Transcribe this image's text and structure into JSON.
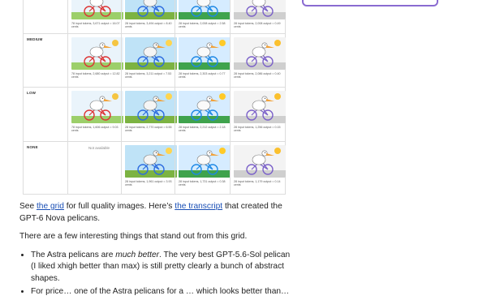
{
  "grid": {
    "rows": [
      {
        "label": "",
        "cells": [
          {
            "caption": "78 input tokens, 3,671 output = 16.07 cents",
            "scene": "a"
          },
          {
            "caption": "28 input tokens, 3,494 output = 8.40 cents",
            "scene": "b"
          },
          {
            "caption": "28 input tokens, 2,008 output = 2.58 cents",
            "scene": "c"
          },
          {
            "caption": "28 input tokens, 2,008 output = 0.49 cents",
            "scene": "d"
          }
        ]
      },
      {
        "label": "MEDIUM",
        "cells": [
          {
            "caption": "78 input tokens, 2,680 output = 12.82 cents",
            "scene": "a"
          },
          {
            "caption": "28 input tokens, 3,211 output = 7.53 cents",
            "scene": "b"
          },
          {
            "caption": "28 input tokens, 2,303 output = 0.77 cents",
            "scene": "c"
          },
          {
            "caption": "28 input tokens, 2,086 output = 0.40 cents",
            "scene": "d"
          }
        ]
      },
      {
        "label": "LOW",
        "cells": [
          {
            "caption": "78 input tokens, 1,606 output = 9.03 cents",
            "scene": "a"
          },
          {
            "caption": "28 input tokens, 2,770 output = 6.55 cents",
            "scene": "b"
          },
          {
            "caption": "28 input tokens, 2,212 output = 2.18 cents",
            "scene": "c"
          },
          {
            "caption": "28 input tokens, 1,256 output = 0.15 cents",
            "scene": "d"
          }
        ]
      },
      {
        "label": "NONE",
        "cells": [
          {
            "caption": "Not available",
            "scene": "none"
          },
          {
            "caption": "28 input tokens, 1,961 output = 3.93 cents",
            "scene": "b"
          },
          {
            "caption": "28 input tokens, 1,731 output = 0.38 cents",
            "scene": "c"
          },
          {
            "caption": "28 input tokens, 1,179 output = 0.14 cents",
            "scene": "d"
          }
        ]
      }
    ]
  },
  "article": {
    "p1_see": "See ",
    "p1_link_grid": "the grid",
    "p1_mid": " for full quality images. Here’s ",
    "p1_link_transcript": "the transcript",
    "p1_end": " that created the GPT-6 Nova pelicans.",
    "p2": "There are a few interesting things that stand out from this grid.",
    "bullet1_a": "The Astra pelicans are ",
    "bullet1_em": "much better",
    "bullet1_b": ". The very best GPT-5.6-Sol pelican (I liked xhigh better than max) is still pretty clearly a bunch of abstract shapes.",
    "bullet2_partial": "For price… one of the Astra pelicans for a … which looks better than…"
  },
  "colors": {
    "link": "#1a4fb5",
    "sidebar_outline": "#8a6bd1",
    "grid_border": "#dddddd"
  }
}
